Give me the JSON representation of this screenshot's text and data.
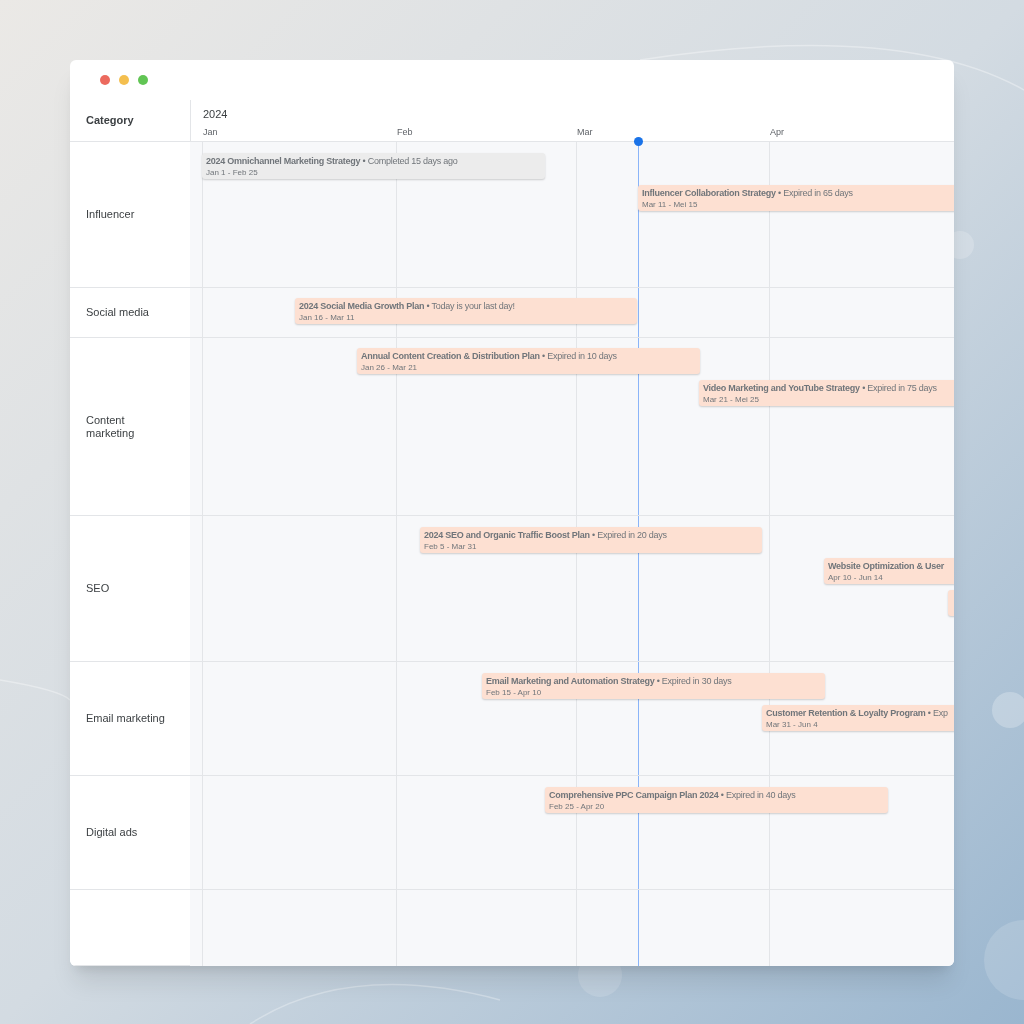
{
  "window": {
    "controls": [
      {
        "color": "#ec6a5e"
      },
      {
        "color": "#f4bf4f"
      },
      {
        "color": "#61c554"
      }
    ]
  },
  "header": {
    "category_label": "Category",
    "year": "2024",
    "months": [
      "Jan",
      "Feb",
      "Mar",
      "Apr"
    ]
  },
  "rows": [
    {
      "category": "Influencer",
      "bars": [
        {
          "text": "**2024 Omnichannel Marketing Strategy** • Completed 15 days ago",
          "dates": "Jan 1 - Feb 25",
          "completed": true
        },
        {
          "text": "**Influencer Collaboration Strategy** • Expired in 65 days",
          "dates": "Mar 11 - Mei 15",
          "completed": false
        }
      ]
    },
    {
      "category": "Social media",
      "bars": [
        {
          "text": "**2024 Social Media Growth Plan** • Today is your last day!",
          "dates": "Jan 16 - Mar 11",
          "completed": false
        }
      ]
    },
    {
      "category": "Content marketing",
      "bars": [
        {
          "text": "**Annual Content Creation & Distribution Plan** • Expired in 10 days",
          "dates": "Jan 26 - Mar 21",
          "completed": false
        },
        {
          "text": "**Video Marketing and YouTube Strategy** • Expired in 75 days",
          "dates": "Mar 21 - Mei 25",
          "completed": false
        }
      ]
    },
    {
      "category": "SEO",
      "bars": [
        {
          "text": "**2024 SEO and Organic Traffic Boost Plan** • Expired in 20 days",
          "dates": "Feb 5 - Mar 31",
          "completed": false
        },
        {
          "text": "**Website Optimization & User**",
          "dates": "Apr 10 - Jun 14",
          "completed": false
        },
        {
          "completed": false
        }
      ]
    },
    {
      "category": "Email marketing",
      "bars": [
        {
          "text": "**Email Marketing and Automation Strategy** • Expired in 30 days",
          "dates": "Feb 15 - Apr 10",
          "completed": false
        },
        {
          "text": "**Customer Retention & Loyalty Program** • Exp",
          "dates": "Mar 31 - Jun 4",
          "completed": false
        }
      ]
    },
    {
      "category": "Digital ads",
      "bars": [
        {
          "text": "**Comprehensive PPC Campaign Plan 2024** • Expired in 40 days",
          "dates": "Feb 25 - Apr 20",
          "completed": false
        }
      ]
    }
  ]
}
